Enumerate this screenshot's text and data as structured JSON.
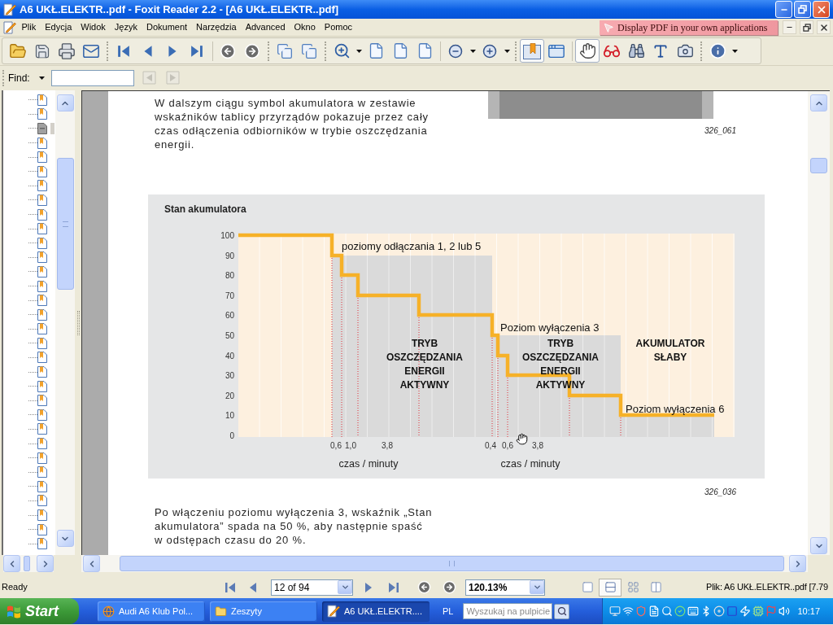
{
  "window": {
    "title": "A6 UKŁ.ELEKTR..pdf - Foxit Reader 2.2 - [A6 UKŁ.ELEKTR..pdf]"
  },
  "menu": [
    "Plik",
    "Edycja",
    "Widok",
    "Język",
    "Dokument",
    "Narzędzia",
    "Advanced",
    "Okno",
    "Pomoc"
  ],
  "ad_banner": "Display PDF in your own applications",
  "toolbar": [
    [
      {
        "kind": "open",
        "selected": false
      },
      {
        "kind": "save",
        "selected": false
      },
      {
        "kind": "print",
        "selected": false
      },
      {
        "kind": "email",
        "selected": false
      }
    ],
    [
      {
        "kind": "first",
        "selected": false
      },
      {
        "kind": "previous",
        "selected": false
      },
      {
        "kind": "next",
        "selected": false
      },
      {
        "kind": "last",
        "selected": false
      },
      {
        "kind": "back",
        "selected": false
      },
      {
        "kind": "forward",
        "selected": false
      }
    ],
    [
      {
        "kind": "extract",
        "selected": false
      },
      {
        "kind": "insert",
        "selected": false
      }
    ],
    [
      {
        "kind": "zoom",
        "selected": false
      },
      {
        "kind": "actual_size",
        "selected": false
      },
      {
        "kind": "fit_page",
        "selected": false
      },
      {
        "kind": "fit_width",
        "selected": false
      },
      {
        "kind": "zoom_out",
        "selected": false
      },
      {
        "kind": "zoom_in",
        "selected": false
      }
    ],
    [
      {
        "kind": "bookmarks",
        "selected": true
      },
      {
        "kind": "full_screen",
        "selected": false
      },
      {
        "kind": "hand",
        "selected": true
      },
      {
        "kind": "reader",
        "selected": false
      },
      {
        "kind": "find",
        "selected": false
      },
      {
        "kind": "text_select",
        "selected": false
      },
      {
        "kind": "snapshot",
        "selected": false
      }
    ],
    [
      {
        "kind": "info",
        "selected": false
      }
    ]
  ],
  "find": {
    "label": "Find:",
    "buttons": [
      {
        "kind": "previous",
        "disabled": true
      },
      {
        "kind": "next",
        "disabled": true
      }
    ]
  },
  "bookmarks": [
    {
      "selected": false
    },
    {
      "selected": false
    },
    {
      "selected": true
    },
    {
      "selected": false
    },
    {
      "selected": false
    },
    {
      "selected": false
    },
    {
      "selected": false
    },
    {
      "selected": false
    },
    {
      "selected": false
    },
    {
      "selected": false
    },
    {
      "selected": false
    },
    {
      "selected": false
    },
    {
      "selected": false
    },
    {
      "selected": false
    },
    {
      "selected": false
    },
    {
      "selected": false
    },
    {
      "selected": false
    },
    {
      "selected": false
    },
    {
      "selected": false
    },
    {
      "selected": false
    },
    {
      "selected": false
    },
    {
      "selected": false
    },
    {
      "selected": false
    },
    {
      "selected": false
    },
    {
      "selected": false
    },
    {
      "selected": false
    },
    {
      "selected": false
    },
    {
      "selected": false
    },
    {
      "selected": false
    },
    {
      "selected": false
    },
    {
      "selected": false
    },
    {
      "selected": false
    }
  ],
  "page": {
    "intro": "W dalszym ciągu symbol akumulatora w zestawie wskaźników tablicy przyrządów pokazuje przez cały czas odłączenia odbiorników w trybie oszczędzania energii.",
    "figure_code_1": "326_061",
    "chart": {
      "title": "Stan akumulatora",
      "y_ticks": [
        "100",
        "90",
        "80",
        "70",
        "60",
        "50",
        "40",
        "30",
        "20",
        "10",
        "0"
      ],
      "time_labels": [
        "0,6",
        "1,0",
        "3,8",
        "0,4",
        "0,6",
        "3,8"
      ],
      "axis_labels": [
        "czas / minuty",
        "czas / minuty"
      ],
      "annotations": [
        "poziomy odłączania 1, 2 lub 5",
        "Poziom wyłączenia 3",
        "Poziom wyłączenia 6"
      ],
      "regions": [
        "TRYB OSZCZĘDZANIA ENERGII AKTYWNY",
        "TRYB OSZCZĘDZANIA ENERGII AKTYWNY",
        "AKUMULATOR SŁABY"
      ]
    },
    "figure_code_2": "326_036",
    "outro": "Po włączeniu poziomu wyłączenia 3, wskaźnik „Stan akumulatora” spada na 50 %, aby następnie spaść w odstępach czasu do 20 %."
  },
  "status_bar": {
    "status": "Ready",
    "page_field": "12 of 94",
    "zoom_field": "120.13%",
    "layouts": [
      {
        "kind": "single",
        "selected": false
      },
      {
        "kind": "continuous",
        "selected": true
      },
      {
        "kind": "continuous_facing",
        "selected": false
      },
      {
        "kind": "facing",
        "selected": false
      }
    ],
    "file_info": "Plik: A6 UKŁ.ELEKTR..pdf [7.79"
  },
  "taskbar": {
    "start": "Start",
    "tasks": [
      {
        "kind": "browser",
        "label": "Audi A6 Klub Pol...",
        "selected": false
      },
      {
        "kind": "folder",
        "label": "Zeszyty",
        "selected": false
      },
      {
        "kind": "pdf",
        "label": "A6 UKŁ.ELEKTR....",
        "selected": true
      }
    ],
    "language": "PL",
    "search": {
      "placeholder": "Wyszukaj na pulpicie"
    },
    "clock": "10:17"
  }
}
